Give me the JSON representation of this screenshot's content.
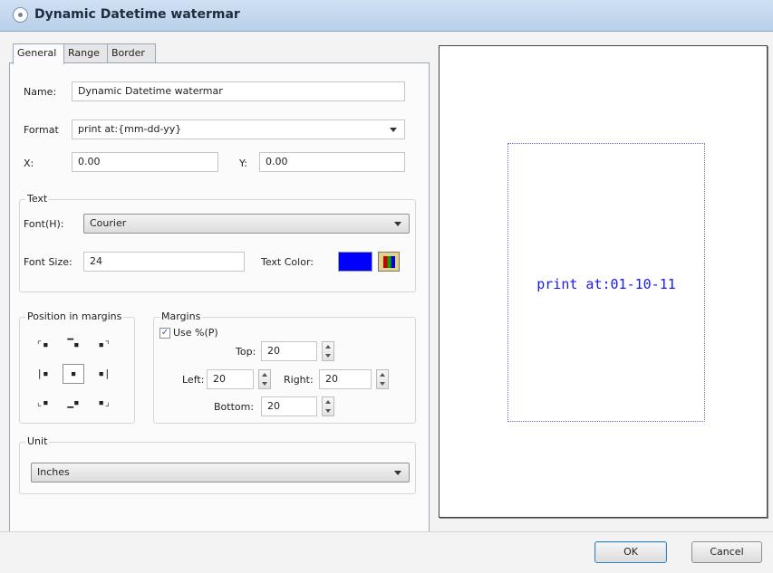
{
  "window": {
    "title": "Dynamic Datetime watermar"
  },
  "tabs": [
    {
      "label": "General",
      "active": true
    },
    {
      "label": "Range",
      "active": false
    },
    {
      "label": "Border",
      "active": false
    }
  ],
  "general": {
    "name_label": "Name:",
    "name_value": "Dynamic Datetime watermar",
    "format_label": "Format",
    "format_value": "print at:{mm-dd-yy}",
    "x_label": "X:",
    "x_value": "0.00",
    "y_label": "Y:",
    "y_value": "0.00"
  },
  "text_group": {
    "title": "Text",
    "font_label": "Font(H):",
    "font_value": "Courier",
    "font_size_label": "Font Size:",
    "font_size_value": "24",
    "text_color_label": "Text Color:",
    "text_color": "#0000ff"
  },
  "position_group": {
    "title": "Position in margins",
    "selected": "center"
  },
  "margins_group": {
    "title": "Margins",
    "use_percent_label": "Use %(P)",
    "use_percent_checked": true,
    "top_label": "Top:",
    "top_value": "20",
    "left_label": "Left:",
    "left_value": "20",
    "right_label": "Right:",
    "right_value": "20",
    "bottom_label": "Bottom:",
    "bottom_value": "20"
  },
  "unit_group": {
    "title": "Unit",
    "value": "Inches"
  },
  "preview": {
    "text": "print at:01-10-11"
  },
  "buttons": {
    "ok": "OK",
    "cancel": "Cancel"
  }
}
